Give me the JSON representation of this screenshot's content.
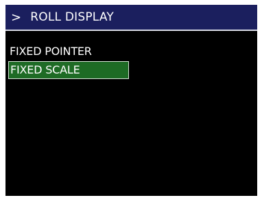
{
  "header": {
    "chevron": ">",
    "title": "ROLL DISPLAY"
  },
  "menu": {
    "items": [
      {
        "label": "FIXED POINTER",
        "selected": false
      },
      {
        "label": "FIXED SCALE",
        "selected": true
      }
    ]
  },
  "colors": {
    "screen_background": "#000000",
    "header_background": "#1b1f5e",
    "selection_background": "#1e6b25",
    "text": "#ffffff"
  }
}
